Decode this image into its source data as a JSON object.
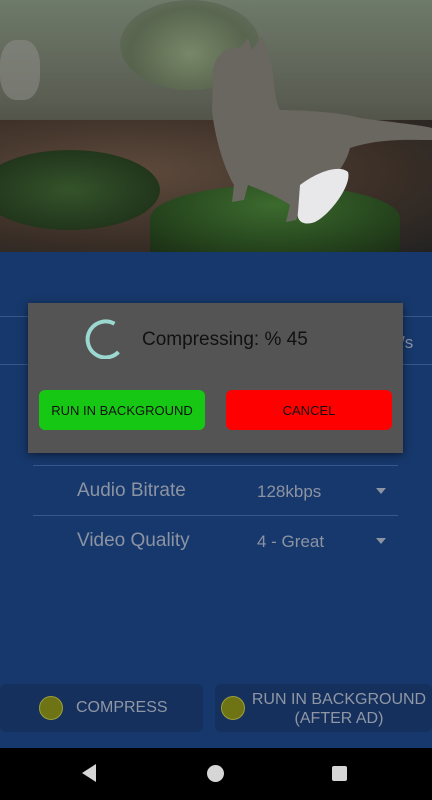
{
  "settings": {
    "rows": [
      {
        "label": "Audio Bitrate",
        "value": "128kbps"
      },
      {
        "label": "Video Quality",
        "value": "4 - Great"
      }
    ],
    "partial_value_suffix": "/s"
  },
  "actions": {
    "compress_label": "COMPRESS",
    "background_label_line1": "RUN IN BACKGROUND",
    "background_label_line2": "(AFTER AD)"
  },
  "dialog": {
    "message": "Compressing: % 45",
    "progress_percent": 45,
    "run_background_label": "RUN IN BACKGROUND",
    "cancel_label": "CANCEL"
  },
  "colors": {
    "main_bg": "#17386c",
    "dialog_bg": "#545454",
    "run_background_button": "#16c814",
    "cancel_button": "#ff0000",
    "spinner": "#9bd8d0"
  },
  "icons": {
    "spinner": "spinner-icon",
    "back": "back-icon",
    "home": "home-icon",
    "recents": "recents-icon"
  }
}
